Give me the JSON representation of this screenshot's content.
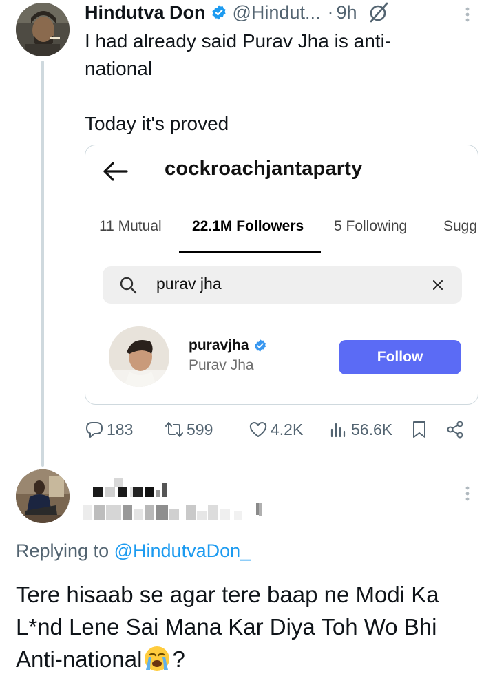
{
  "tweet": {
    "author_name": "Hindutva Don",
    "handle": "@Hindut...",
    "separator": "·",
    "time": "9h",
    "text_line1": "I had already said Purav Jha is anti-",
    "text_line2": "national",
    "text_line3": "Today it's proved",
    "embed": {
      "username": "cockroachjantaparty",
      "tabs": [
        "11 Mutual",
        "22.1M Followers",
        "5 Following",
        "Sugg"
      ],
      "active_tab": "22.1M Followers",
      "search_value": "purav jha",
      "result_username": "puravjha",
      "result_fullname": "Purav Jha",
      "follow_label": "Follow"
    },
    "actions": {
      "replies": "183",
      "reposts": "599",
      "likes": "4.2K",
      "views": "56.6K"
    }
  },
  "reply": {
    "replying_prefix": "Replying to",
    "replying_handle": "@HindutvaDon_",
    "text_line1": "Tere hisaab se agar tere baap ne Modi Ka",
    "text_line2": "L*nd Lene Sai Mana Kar Diya Toh Wo Bhi",
    "text_line3": "Anti-national",
    "text_end": "?",
    "emoji": "loudly-crying-face"
  },
  "colors": {
    "text": "#0f1419",
    "secondary": "#536471",
    "link": "#1d9bf0",
    "verified": "#1d9bf0",
    "thread_line": "#cfd9de",
    "ig_follow": "#5b6bf5"
  }
}
